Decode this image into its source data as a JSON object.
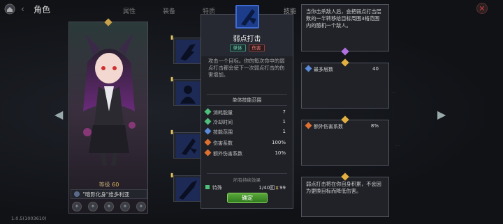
{
  "header": {
    "title": "角色",
    "tabs": [
      "属性",
      "装备",
      "特质",
      "技能"
    ]
  },
  "character": {
    "level_label": "等级",
    "level_value": "60",
    "name": "\"暗影化身\"维多利亚",
    "stars": 5
  },
  "skill": {
    "name": "弱点打击",
    "tags": [
      "单体",
      "伤害"
    ],
    "description": "攻击一个目标。你的每次命中的弱点打击都会使下一次弱点打击的伤害增加。",
    "range_title": "单体技能范围",
    "stats": [
      {
        "label": "消耗能量",
        "value": "7",
        "color": "#4fc07a"
      },
      {
        "label": "冷却时间",
        "value": "1",
        "color": "#4fc07a"
      },
      {
        "label": "技能范围",
        "value": "1",
        "color": "#5a8ad8"
      },
      {
        "label": "伤害系数",
        "value": "100%",
        "color": "#e07030"
      },
      {
        "label": "额外伤害系数",
        "value": "10%",
        "color": "#e07030"
      }
    ],
    "continuous_title": "所有持续效果",
    "special_label": "特殊",
    "special_value": "1/40回",
    "special_value2": "99",
    "confirm_label": "确定"
  },
  "panels": [
    {
      "text": "当你击杀敌人后，会把弱点打击层数的一半转移给目标周围3格范围内的随机一个敌人。",
      "gem_color": "#b070e0"
    },
    {
      "stat_label": "最多层数",
      "stat_value": "40",
      "gem_color": "#e0b040"
    },
    {
      "stat_label": "额外伤害系数",
      "stat_value": "8%",
      "gem_color": "#e0b040"
    },
    {
      "text": "弱点打击将在你自身积累，不会因为更换目标而降低伤害。",
      "gem_color": "#e0b040"
    }
  ],
  "version": "1.0.5(1003610)",
  "colors": {
    "accent_green": "#4fc07a",
    "accent_gold": "#e0b040",
    "skill_blue": "#1d3d8a"
  }
}
